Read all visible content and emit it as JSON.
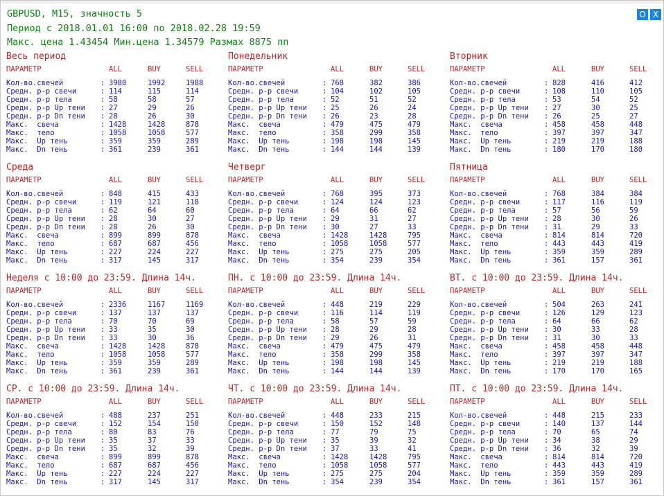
{
  "header": {
    "line1": "GBPUSD, M15, значность 5",
    "line2": "Период с 2018.01.01 16:00 по 2018.02.28 19:59",
    "line3": "Макс. цена 1.43454 Мин.цена 1.34579 Размах 8875 пп"
  },
  "buttons": {
    "o_label": "O",
    "x_label": "X"
  },
  "colors": {
    "header_green": "#128012",
    "title_red": "#b02a2a",
    "value_blue": "#1818a0",
    "button_blue": "#1a86d9"
  },
  "columns": {
    "param": "ПАРАМЕТР",
    "all": "ALL",
    "buy": "BUY",
    "sell": "SELL"
  },
  "labels": [
    "Кол-во.свечей",
    "Средн. р-р свечи",
    "Средн. р-р тела",
    "Средн. р-р Up тени",
    "Средн. р-р Dn тени",
    "Макс.  свеча",
    "Макс.  тело",
    "Макс.  Up тень",
    "Макс.  Dn тень"
  ],
  "colon": ":",
  "blocks": [
    {
      "title": "Весь период",
      "rows": [
        [
          "3980",
          "1992",
          "1988"
        ],
        [
          "114",
          "115",
          "114"
        ],
        [
          "58",
          "58",
          "57"
        ],
        [
          "27",
          "29",
          "26"
        ],
        [
          "28",
          "26",
          "30"
        ],
        [
          "1428",
          "1428",
          "878"
        ],
        [
          "1058",
          "1058",
          "577"
        ],
        [
          "359",
          "359",
          "289"
        ],
        [
          "361",
          "239",
          "361"
        ]
      ]
    },
    {
      "title": "Понедельник",
      "rows": [
        [
          "768",
          "382",
          "386"
        ],
        [
          "104",
          "102",
          "105"
        ],
        [
          "52",
          "51",
          "52"
        ],
        [
          "25",
          "26",
          "24"
        ],
        [
          "26",
          "23",
          "28"
        ],
        [
          "479",
          "475",
          "479"
        ],
        [
          "358",
          "299",
          "358"
        ],
        [
          "198",
          "198",
          "145"
        ],
        [
          "144",
          "144",
          "139"
        ]
      ]
    },
    {
      "title": "Вторник",
      "rows": [
        [
          "828",
          "416",
          "412"
        ],
        [
          "108",
          "110",
          "105"
        ],
        [
          "53",
          "54",
          "52"
        ],
        [
          "27",
          "30",
          "25"
        ],
        [
          "26",
          "25",
          "27"
        ],
        [
          "458",
          "458",
          "448"
        ],
        [
          "397",
          "397",
          "347"
        ],
        [
          "219",
          "219",
          "188"
        ],
        [
          "180",
          "170",
          "180"
        ]
      ]
    },
    {
      "title": "Среда",
      "rows": [
        [
          "848",
          "415",
          "433"
        ],
        [
          "119",
          "121",
          "118"
        ],
        [
          "62",
          "64",
          "60"
        ],
        [
          "28",
          "30",
          "27"
        ],
        [
          "28",
          "26",
          "30"
        ],
        [
          "899",
          "899",
          "878"
        ],
        [
          "687",
          "687",
          "456"
        ],
        [
          "227",
          "224",
          "227"
        ],
        [
          "317",
          "145",
          "317"
        ]
      ]
    },
    {
      "title": "Четверг",
      "rows": [
        [
          "768",
          "395",
          "373"
        ],
        [
          "124",
          "124",
          "123"
        ],
        [
          "64",
          "66",
          "62"
        ],
        [
          "29",
          "31",
          "27"
        ],
        [
          "30",
          "27",
          "33"
        ],
        [
          "1428",
          "1428",
          "795"
        ],
        [
          "1058",
          "1058",
          "577"
        ],
        [
          "275",
          "275",
          "205"
        ],
        [
          "354",
          "239",
          "354"
        ]
      ]
    },
    {
      "title": "Пятница",
      "rows": [
        [
          "768",
          "384",
          "384"
        ],
        [
          "117",
          "116",
          "119"
        ],
        [
          "57",
          "56",
          "59"
        ],
        [
          "28",
          "30",
          "26"
        ],
        [
          "31",
          "29",
          "33"
        ],
        [
          "814",
          "814",
          "720"
        ],
        [
          "443",
          "443",
          "419"
        ],
        [
          "359",
          "359",
          "289"
        ],
        [
          "361",
          "157",
          "361"
        ]
      ]
    },
    {
      "title": "Неделя с 10:00 до 23:59. Длина 14ч.",
      "rows": [
        [
          "2336",
          "1167",
          "1169"
        ],
        [
          "137",
          "137",
          "137"
        ],
        [
          "70",
          "70",
          "69"
        ],
        [
          "33",
          "35",
          "30"
        ],
        [
          "33",
          "30",
          "36"
        ],
        [
          "1428",
          "1428",
          "878"
        ],
        [
          "1058",
          "1058",
          "577"
        ],
        [
          "359",
          "359",
          "289"
        ],
        [
          "361",
          "239",
          "361"
        ]
      ]
    },
    {
      "title": "ПН. с 10:00 до 23:59. Длина 14ч.",
      "rows": [
        [
          "448",
          "219",
          "229"
        ],
        [
          "116",
          "114",
          "119"
        ],
        [
          "58",
          "57",
          "59"
        ],
        [
          "28",
          "29",
          "28"
        ],
        [
          "29",
          "26",
          "31"
        ],
        [
          "479",
          "475",
          "479"
        ],
        [
          "358",
          "299",
          "358"
        ],
        [
          "198",
          "198",
          "145"
        ],
        [
          "144",
          "144",
          "139"
        ]
      ]
    },
    {
      "title": "ВТ. с 10:00 до 23:59. Длина 14ч.",
      "rows": [
        [
          "504",
          "263",
          "241"
        ],
        [
          "126",
          "129",
          "123"
        ],
        [
          "64",
          "66",
          "62"
        ],
        [
          "30",
          "33",
          "28"
        ],
        [
          "31",
          "30",
          "33"
        ],
        [
          "458",
          "458",
          "448"
        ],
        [
          "397",
          "397",
          "347"
        ],
        [
          "219",
          "219",
          "188"
        ],
        [
          "170",
          "170",
          "165"
        ]
      ]
    },
    {
      "title": "СР. с 10:00 до 23:59. Длина 14ч.",
      "rows": [
        [
          "488",
          "237",
          "251"
        ],
        [
          "152",
          "154",
          "150"
        ],
        [
          "80",
          "83",
          "76"
        ],
        [
          "35",
          "37",
          "33"
        ],
        [
          "35",
          "32",
          "39"
        ],
        [
          "899",
          "899",
          "878"
        ],
        [
          "687",
          "687",
          "456"
        ],
        [
          "227",
          "224",
          "227"
        ],
        [
          "317",
          "145",
          "317"
        ]
      ]
    },
    {
      "title": "ЧТ. с 10:00 до 23:59. Длина 14ч.",
      "rows": [
        [
          "448",
          "233",
          "215"
        ],
        [
          "150",
          "152",
          "148"
        ],
        [
          "77",
          "79",
          "75"
        ],
        [
          "35",
          "39",
          "32"
        ],
        [
          "37",
          "33",
          "41"
        ],
        [
          "1428",
          "1428",
          "795"
        ],
        [
          "1058",
          "1058",
          "577"
        ],
        [
          "275",
          "275",
          "204"
        ],
        [
          "354",
          "239",
          "354"
        ]
      ]
    },
    {
      "title": "ПТ. с 10:00 до 23:59. Длина 14ч.",
      "rows": [
        [
          "448",
          "215",
          "233"
        ],
        [
          "140",
          "137",
          "144"
        ],
        [
          "70",
          "65",
          "74"
        ],
        [
          "34",
          "38",
          "29"
        ],
        [
          "36",
          "32",
          "39"
        ],
        [
          "814",
          "814",
          "720"
        ],
        [
          "443",
          "443",
          "419"
        ],
        [
          "359",
          "359",
          "289"
        ],
        [
          "361",
          "157",
          "361"
        ]
      ]
    }
  ]
}
